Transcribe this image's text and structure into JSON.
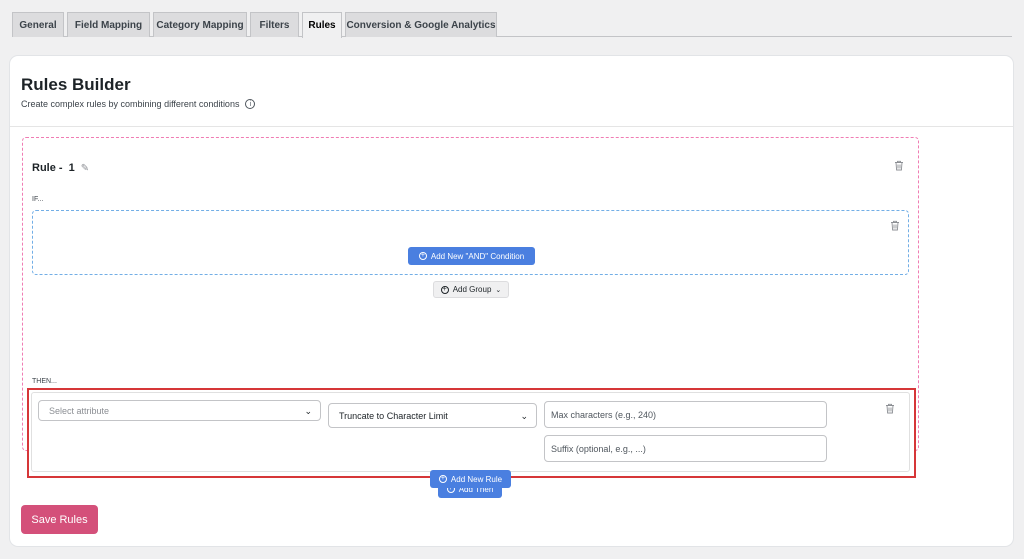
{
  "tabs": [
    {
      "label": "General"
    },
    {
      "label": "Field Mapping"
    },
    {
      "label": "Category Mapping"
    },
    {
      "label": "Filters"
    },
    {
      "label": "Rules"
    },
    {
      "label": "Conversion & Google Analytics"
    }
  ],
  "active_tab": "Rules",
  "page": {
    "title": "Rules Builder",
    "subtitle": "Create complex rules by combining different conditions"
  },
  "rule": {
    "title": "Rule - ",
    "number": "1",
    "if_label": "IF...",
    "then_label": "THEN...",
    "add_and_condition": "Add New \"AND\" Condition",
    "add_group": "Add Group",
    "add_then": "Add Then",
    "then_action": {
      "attribute_placeholder": "Select attribute",
      "action_value": "Truncate to Character Limit",
      "max_chars_placeholder": "Max characters (e.g., 240)",
      "suffix_placeholder": "Suffix (optional, e.g., ...)"
    }
  },
  "add_new_rule": "Add New Rule",
  "save_rules": "Save Rules",
  "colors": {
    "primary_blue": "#4a7fe0",
    "save_pink": "#d4507a",
    "rule_border": "#f07cb3",
    "if_border": "#72aee6",
    "highlight_red": "#d63638"
  }
}
